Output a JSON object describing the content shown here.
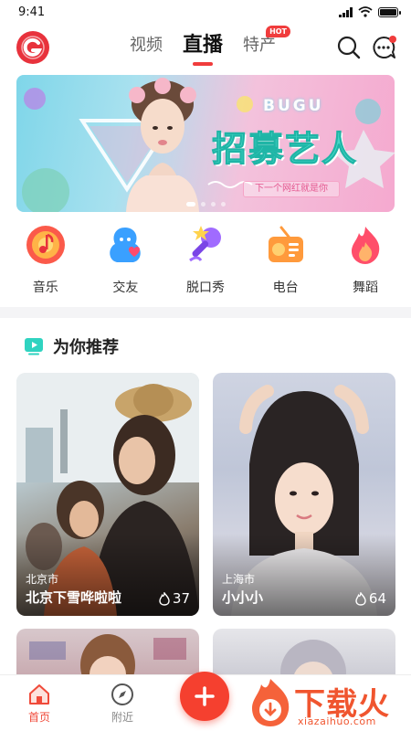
{
  "status_bar": {
    "time": "9:41"
  },
  "top_nav": {
    "tabs": [
      {
        "label": "视频"
      },
      {
        "label": "直播"
      },
      {
        "label": "特产",
        "badge": "HOT"
      }
    ],
    "active_tab": "直播"
  },
  "banner": {
    "brand": "BUGU",
    "title": "招募艺人",
    "subtitle": "下一个网红就是你",
    "page_count": 4,
    "active_page": 1
  },
  "categories": [
    {
      "label": "音乐",
      "icon": "music-note-icon"
    },
    {
      "label": "交友",
      "icon": "heart-person-icon"
    },
    {
      "label": "脱口秀",
      "icon": "microphone-icon"
    },
    {
      "label": "电台",
      "icon": "radio-icon"
    },
    {
      "label": "舞蹈",
      "icon": "flame-icon"
    }
  ],
  "recommend": {
    "title": "为你推荐",
    "cards": [
      {
        "city": "北京市",
        "name": "北京下雪哗啦啦",
        "heat": "37"
      },
      {
        "city": "上海市",
        "name": "小小小",
        "heat": "64"
      }
    ]
  },
  "bottom_nav": {
    "items": [
      {
        "label": "首页",
        "icon": "home-icon"
      },
      {
        "label": "附近",
        "icon": "compass-icon"
      }
    ],
    "publish_icon": "plus-icon"
  },
  "watermark": {
    "text": "下载火",
    "domain": "xiazaihuo.com"
  },
  "colors": {
    "accent": "#f03c3c",
    "teal": "#46d6c7",
    "divider": "#f4f4f6"
  }
}
